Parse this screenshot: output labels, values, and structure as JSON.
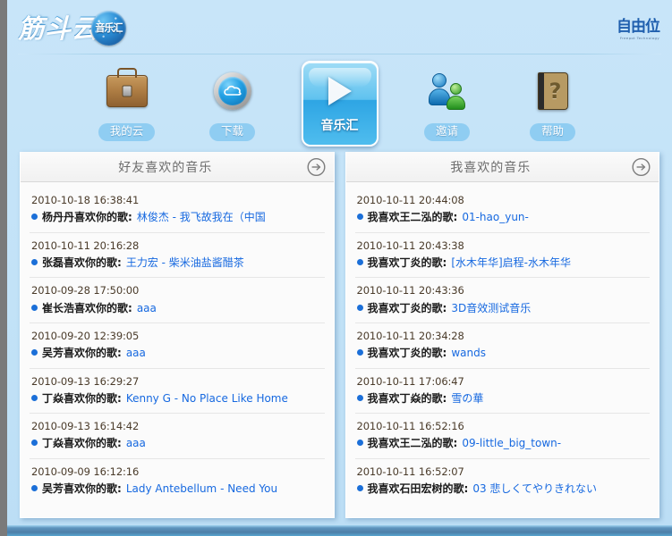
{
  "header": {
    "logo_text": "筋斗云",
    "logo_badge_text": "音乐汇",
    "brandmark": "自由位",
    "brandmark_sub": "Freepot Technology"
  },
  "nav": {
    "items": [
      {
        "label": "我的云",
        "icon": "briefcase-icon",
        "active": false
      },
      {
        "label": "下载",
        "icon": "cloud-download-icon",
        "active": false
      },
      {
        "label": "音乐汇",
        "icon": "play-icon",
        "active": true
      },
      {
        "label": "邀请",
        "icon": "people-icon",
        "active": false
      },
      {
        "label": "帮助",
        "icon": "help-book-icon",
        "active": false
      }
    ]
  },
  "panels": [
    {
      "title": "好友喜欢的音乐",
      "arrow_icon": "arrow-right-circle-icon",
      "entries": [
        {
          "time": "2010-10-18 16:38:41",
          "actor": "杨丹丹喜欢你的歌:",
          "song": "林俊杰 - 我飞故我在（中国"
        },
        {
          "time": "2010-10-11 20:16:28",
          "actor": "张磊喜欢你的歌:",
          "song": "王力宏 - 柴米油盐酱醋茶"
        },
        {
          "time": "2010-09-28 17:50:00",
          "actor": "崔长浩喜欢你的歌:",
          "song": "aaa"
        },
        {
          "time": "2010-09-20 12:39:05",
          "actor": "吴芳喜欢你的歌:",
          "song": "aaa"
        },
        {
          "time": "2010-09-13 16:29:27",
          "actor": "丁焱喜欢你的歌:",
          "song": "Kenny G - No Place Like Home"
        },
        {
          "time": "2010-09-13 16:14:42",
          "actor": "丁焱喜欢你的歌:",
          "song": "aaa"
        },
        {
          "time": "2010-09-09 16:12:16",
          "actor": "吴芳喜欢你的歌:",
          "song": "Lady Antebellum - Need You"
        }
      ]
    },
    {
      "title": "我喜欢的音乐",
      "arrow_icon": "arrow-right-circle-icon",
      "entries": [
        {
          "time": "2010-10-11 20:44:08",
          "actor": "我喜欢王二泓的歌:",
          "song": "01-hao_yun-"
        },
        {
          "time": "2010-10-11 20:43:38",
          "actor": "我喜欢丁炎的歌:",
          "song": "[水木年华]启程-水木年华"
        },
        {
          "time": "2010-10-11 20:43:36",
          "actor": "我喜欢丁炎的歌:",
          "song": "3D音效测试音乐"
        },
        {
          "time": "2010-10-11 20:34:28",
          "actor": "我喜欢丁炎的歌:",
          "song": "wands"
        },
        {
          "time": "2010-10-11 17:06:47",
          "actor": "我喜欢丁焱的歌:",
          "song": "雪の華"
        },
        {
          "time": "2010-10-11 16:52:16",
          "actor": "我喜欢王二泓的歌:",
          "song": "09-little_big_town-"
        },
        {
          "time": "2010-10-11 16:52:07",
          "actor": "我喜欢石田宏树的歌:",
          "song": "03 悲しくてやりきれない"
        }
      ]
    }
  ],
  "colors": {
    "page_background": "#c6e4f8",
    "link": "#1769e0",
    "bullet": "#1b6fd8",
    "nav_pill": "#8fcdf2",
    "panel_background": "#fbfbfb",
    "outer_frame": "#7a7a7a"
  }
}
